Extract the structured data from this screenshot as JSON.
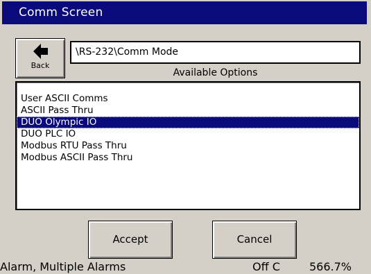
{
  "window": {
    "title": "Comm Screen"
  },
  "back_button": {
    "label": "Back",
    "icon": "arrow-left-icon"
  },
  "path": {
    "value": "\\RS-232\\Comm Mode"
  },
  "options": {
    "caption": "Available Options",
    "items": [
      {
        "label": "User ASCII Comms",
        "selected": false
      },
      {
        "label": "ASCII Pass Thru",
        "selected": false
      },
      {
        "label": "DUO Olympic IO",
        "selected": true
      },
      {
        "label": "DUO PLC IO",
        "selected": false
      },
      {
        "label": "Modbus RTU Pass Thru",
        "selected": false
      },
      {
        "label": "Modbus ASCII Pass Thru",
        "selected": false
      }
    ]
  },
  "buttons": {
    "accept": "Accept",
    "cancel": "Cancel"
  },
  "status": {
    "message": "Alarm, Multiple Alarms",
    "mode": "Off C",
    "value": "566.7%"
  },
  "colors": {
    "title_bar": "#0a0a7c",
    "selection": "#0a0a7c",
    "face": "#d4d0c8"
  }
}
